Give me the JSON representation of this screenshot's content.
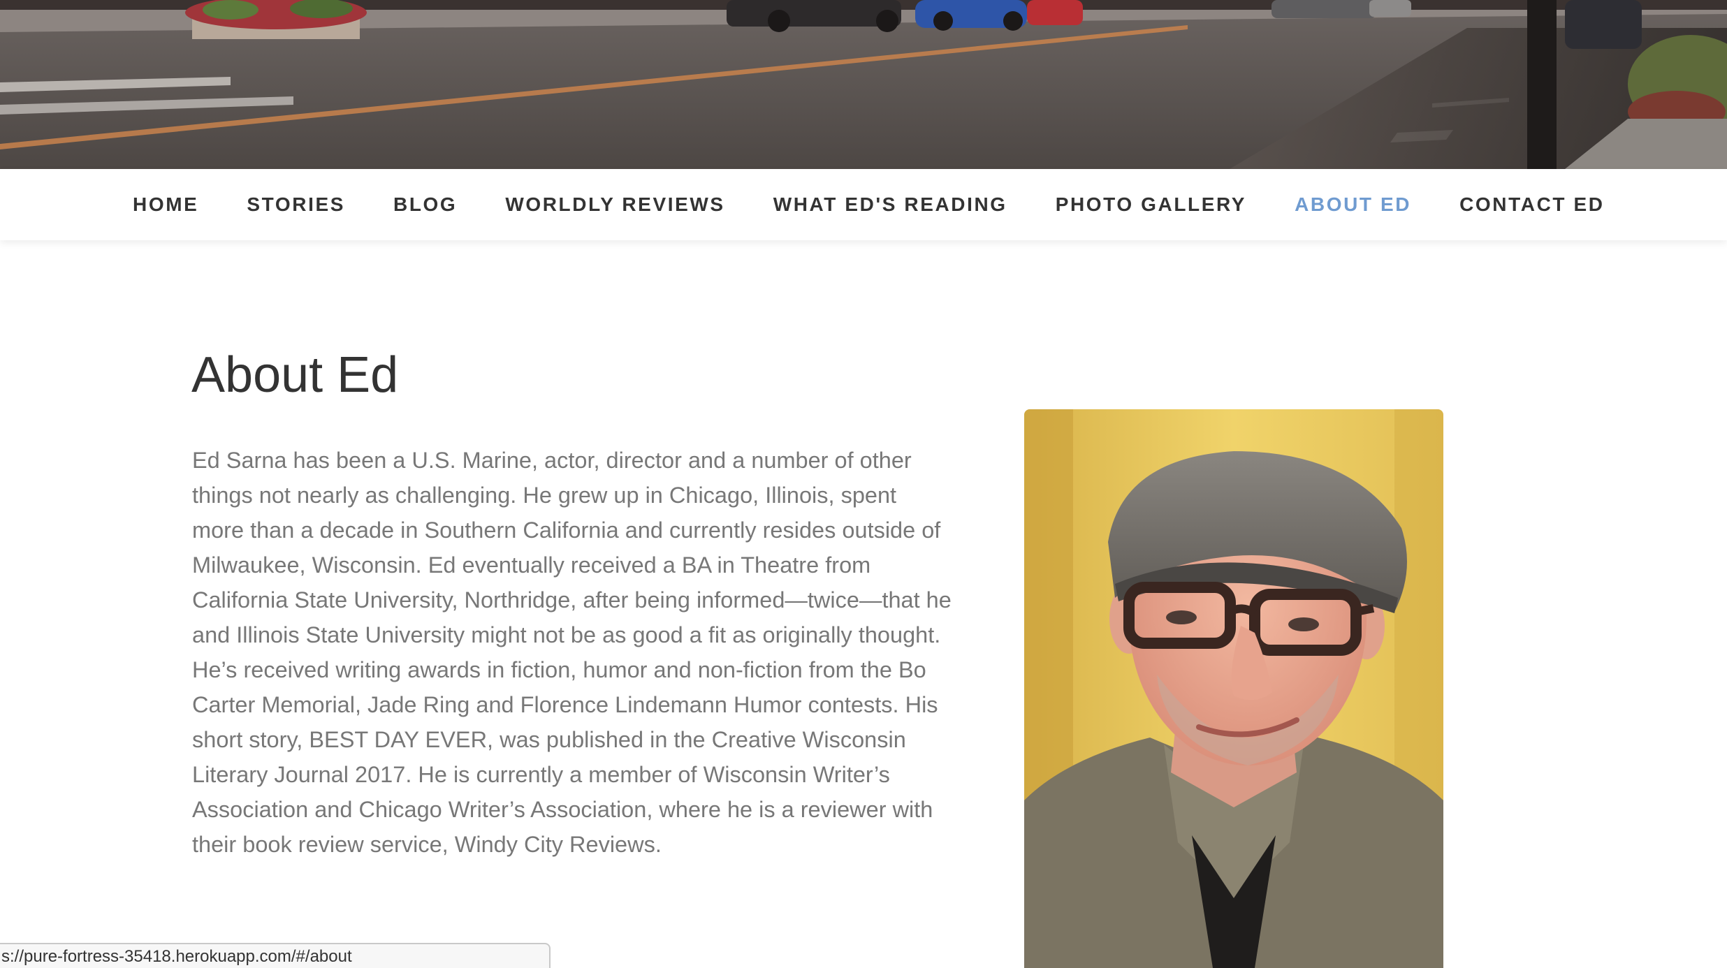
{
  "nav": {
    "items": [
      {
        "label": "HOME",
        "active": false
      },
      {
        "label": "STORIES",
        "active": false
      },
      {
        "label": "BLOG",
        "active": false
      },
      {
        "label": "WORLDLY REVIEWS",
        "active": false
      },
      {
        "label": "WHAT ED'S READING",
        "active": false
      },
      {
        "label": "PHOTO GALLERY",
        "active": false
      },
      {
        "label": "ABOUT ED",
        "active": true
      },
      {
        "label": "CONTACT ED",
        "active": false
      }
    ],
    "active_color": "#6f9bd0",
    "text_color": "#333333"
  },
  "main": {
    "title": "About Ed",
    "bio": "Ed Sarna has been a U.S. Marine, actor, director and a number of other things not nearly as challenging. He grew up in Chicago, Illinois, spent more than a decade in Southern California and currently resides outside of Milwaukee, Wisconsin. Ed eventually received a BA in Theatre from California State University, Northridge, after being informed—twice—that he and Illinois State University might not be as good a fit as originally thought. He’s received writing awards in fiction, humor and non-fiction from the Bo Carter Memorial, Jade Ring and Florence Lindemann Humor contests. His short story, BEST DAY EVER, was published in the Creative Wisconsin Literary Journal 2017. He is currently a member of Wisconsin Writer’s Association and Chicago Writer’s Association, where he is a reviewer with their book review service, Windy City Reviews."
  },
  "status_bar": {
    "url": "s://pure-fortress-35418.herokuapp.com/#/about"
  }
}
